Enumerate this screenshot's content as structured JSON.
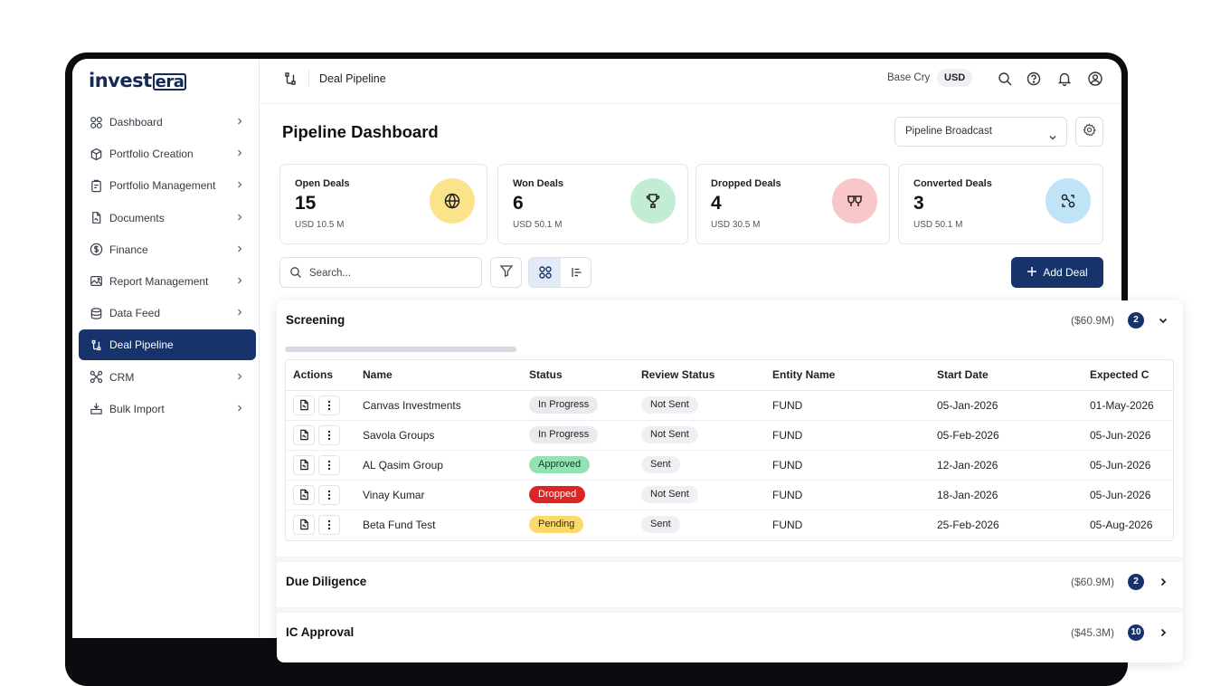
{
  "app": {
    "logo_main": "invest",
    "logo_box": "era"
  },
  "sidebar": {
    "items": [
      {
        "label": "Dashboard",
        "icon": "grid-icon",
        "has_chevron": true
      },
      {
        "label": "Portfolio Creation",
        "icon": "cube-icon",
        "has_chevron": true
      },
      {
        "label": "Portfolio Management",
        "icon": "clipboard-icon",
        "has_chevron": true
      },
      {
        "label": "Documents",
        "icon": "document-icon",
        "has_chevron": true
      },
      {
        "label": "Finance",
        "icon": "dollar-icon",
        "has_chevron": true
      },
      {
        "label": "Report Management",
        "icon": "image-report-icon",
        "has_chevron": true
      },
      {
        "label": "Data Feed",
        "icon": "database-icon",
        "has_chevron": true
      },
      {
        "label": "Deal Pipeline",
        "icon": "pipeline-icon",
        "has_chevron": false,
        "active": true
      },
      {
        "label": "CRM",
        "icon": "network-icon",
        "has_chevron": true
      },
      {
        "label": "Bulk Import",
        "icon": "import-icon",
        "has_chevron": true
      }
    ]
  },
  "topbar": {
    "breadcrumb": "Deal Pipeline",
    "base_label": "Base Cry",
    "currency": "USD",
    "icons": [
      "search-icon",
      "help-icon",
      "bell-icon",
      "user-icon"
    ]
  },
  "main": {
    "title": "Pipeline Dashboard",
    "broadcast_select": "Pipeline Broadcast"
  },
  "cards": [
    {
      "title": "Open Deals",
      "value": "15",
      "sub": "USD 10.5 M",
      "icon": "globe-icon",
      "color": "#fbe38a"
    },
    {
      "title": "Won Deals",
      "value": "6",
      "sub": "USD 50.1 M",
      "icon": "trophy-icon",
      "color": "#c2ecd3"
    },
    {
      "title": "Dropped Deals",
      "value": "4",
      "sub": "USD 30.5 M",
      "icon": "disconnect-icon",
      "color": "#f9c7c7"
    },
    {
      "title": "Converted Deals",
      "value": "3",
      "sub": "USD 50.1 M",
      "icon": "convert-icon",
      "color": "#bfe3f7"
    }
  ],
  "toolbar": {
    "search_placeholder": "Search...",
    "add_deal": "Add Deal"
  },
  "sections": [
    {
      "title": "Screening",
      "amount": "($60.9M)",
      "count": "2",
      "expanded": true,
      "columns": [
        "Actions",
        "Name",
        "Status",
        "Review Status",
        "Entity Name",
        "Start Date",
        "Expected C"
      ],
      "rows": [
        {
          "name": "Canvas Investments",
          "status": "In Progress",
          "review": "Not Sent",
          "entity": "FUND",
          "start": "05-Jan-2026",
          "expected": "01-May-2026"
        },
        {
          "name": "Savola Groups",
          "status": "In Progress",
          "review": "Not Sent",
          "entity": "FUND",
          "start": "05-Feb-2026",
          "expected": "05-Jun-2026"
        },
        {
          "name": "AL Qasim Group",
          "status": "Approved",
          "review": "Sent",
          "entity": "FUND",
          "start": "12-Jan-2026",
          "expected": "05-Jun-2026"
        },
        {
          "name": "Vinay Kumar",
          "status": "Dropped",
          "review": "Not Sent",
          "entity": "FUND",
          "start": "18-Jan-2026",
          "expected": "05-Jun-2026"
        },
        {
          "name": "Beta Fund Test",
          "status": "Pending",
          "review": "Sent",
          "entity": "FUND",
          "start": "25-Feb-2026",
          "expected": "05-Aug-2026"
        }
      ]
    },
    {
      "title": "Due Diligence",
      "amount": "($60.9M)",
      "count": "2",
      "expanded": false
    },
    {
      "title": "IC Approval",
      "amount": "($45.3M)",
      "count": "10",
      "expanded": false
    }
  ]
}
